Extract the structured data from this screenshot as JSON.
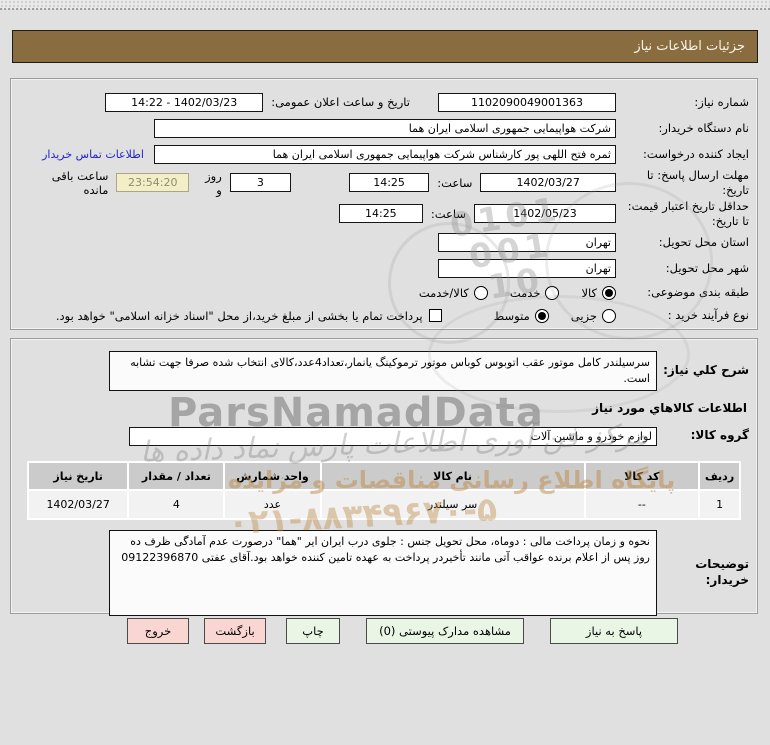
{
  "header": {
    "title": "جزئیات اطلاعات نیاز"
  },
  "form": {
    "need_number": {
      "label": "شماره نیاز:",
      "value": "1102090049001363"
    },
    "announce": {
      "label": "تاریخ و ساعت اعلان عمومی:",
      "value": "1402/03/23 - 14:22"
    },
    "buyer_org": {
      "label": "نام دستگاه خریدار:",
      "value": "شرکت هواپیمایی جمهوری اسلامی ایران هما"
    },
    "creator": {
      "label": "ایجاد کننده درخواست:",
      "value": "ثمره فتح اللهی پور کارشناس شرکت هواپیمایی جمهوری اسلامی ایران هما",
      "contact_link": "اطلاعات تماس خریدار"
    },
    "deadline": {
      "label": "مهلت ارسال پاسخ: تا تاریخ:",
      "date": "1402/03/27",
      "hour_label": "ساعت:",
      "time": "14:25",
      "days": "3",
      "days_label": "روز و",
      "countdown": "23:54:20",
      "countdown_label": "ساعت باقی مانده"
    },
    "validity": {
      "label": "حداقل تاریخ اعتبار قیمت: تا تاریخ:",
      "date": "1402/05/23",
      "hour_label": "ساعت:",
      "time": "14:25"
    },
    "province": {
      "label": "استان محل تحویل:",
      "value": "تهران"
    },
    "city": {
      "label": "شهر محل تحویل:",
      "value": "تهران"
    },
    "category": {
      "label": "طبقه بندی موضوعی:",
      "options": [
        {
          "label": "کالا",
          "selected": true
        },
        {
          "label": "خدمت",
          "selected": false
        },
        {
          "label": "کالا/خدمت",
          "selected": false
        }
      ]
    },
    "process": {
      "label": "نوع فرآیند خرید :",
      "options": [
        {
          "label": "جزیی",
          "selected": false
        },
        {
          "label": "متوسط",
          "selected": true
        }
      ],
      "treasury_checkbox": {
        "label": "پرداخت تمام یا بخشی از مبلغ خرید،از محل \"اسناد خزانه اسلامی\" خواهد بود.",
        "checked": false
      }
    }
  },
  "need_section": {
    "desc_label": "شرح کلي نیاز:",
    "desc_value": "سرسیلندر کامل موتور عقب اتوبوس کوباس موتور ترموکینگ یانمار،تعداد4عدد،کالای انتخاب شده صرفا جهت تشابه است.",
    "items_header": "اطلاعات کالاهاي مورد نیاز",
    "group_label": "گروه کالا:",
    "group_value": "لوازم خودرو و ماشین آلات"
  },
  "items_table": {
    "headers": [
      "ردیف",
      "کد کالا",
      "نام کالا",
      "واحد شمارش",
      "تعداد / مقدار",
      "تاریخ نیاز"
    ],
    "rows": [
      {
        "row": "1",
        "code": "--",
        "name": "سر سیلندر",
        "unit": "عدد",
        "qty": "4",
        "date": "1402/03/27"
      }
    ]
  },
  "notes": {
    "label": "توضیحات خریدار:",
    "value": "نحوه و زمان پرداخت مالی  : دوماه، محل تحویل جنس : جلوی درب ایران ایر \"هما\"  درصورت عدم آمادگی ظرف ده روز پس از اعلام برنده عواقب آتی مانند تأخیردر پرداخت به عهده تامین کننده خواهد بود.آقای عفتی 09122396870"
  },
  "buttons": {
    "respond": "پاسخ به نیاز",
    "attachments": "مشاهده مدارک پیوستی (0)",
    "print": "چاپ",
    "back": "بازگشت",
    "exit": "خروج"
  },
  "watermark": {
    "brand": "ParsNamadData",
    "calligraphy": "مرکز فن آوری اطلاعات پارس نماد داده ها",
    "slogan": "پایگاه اطلاع رسانی مناقصات و مزایده",
    "phone": "۰۲۱-۸۸۳۴۹۶۷۰-۵",
    "seal_line1": "0101",
    "seal_line2": "001",
    "seal_line3": "10"
  }
}
